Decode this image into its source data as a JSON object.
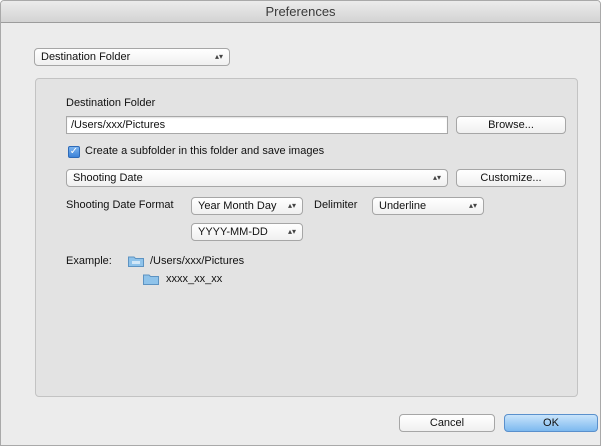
{
  "window": {
    "title": "Preferences"
  },
  "category_select": {
    "value": "Destination Folder",
    "arrows": "⇕"
  },
  "section": {
    "heading": "Destination Folder",
    "path_value": "/Users/xxx/Pictures",
    "browse_label": "Browse...",
    "subfolder_checkbox": {
      "checked": true,
      "label": "Create a subfolder in this folder and save images"
    },
    "subfolder_type": {
      "value": "Shooting Date"
    },
    "customize_label": "Customize...",
    "date_format_label": "Shooting Date Format",
    "date_format_value": "Year Month Day",
    "delimiter_label": "Delimiter",
    "delimiter_value": "Underline",
    "date_pattern_value": "YYYY-MM-DD",
    "example_label": "Example:",
    "example_path": "/Users/xxx/Pictures",
    "example_subfolder": "xxxx_xx_xx"
  },
  "footer": {
    "cancel_label": "Cancel",
    "ok_label": "OK"
  },
  "colors": {
    "accent": "#7db9ef",
    "folder": "#8fc3ea"
  }
}
